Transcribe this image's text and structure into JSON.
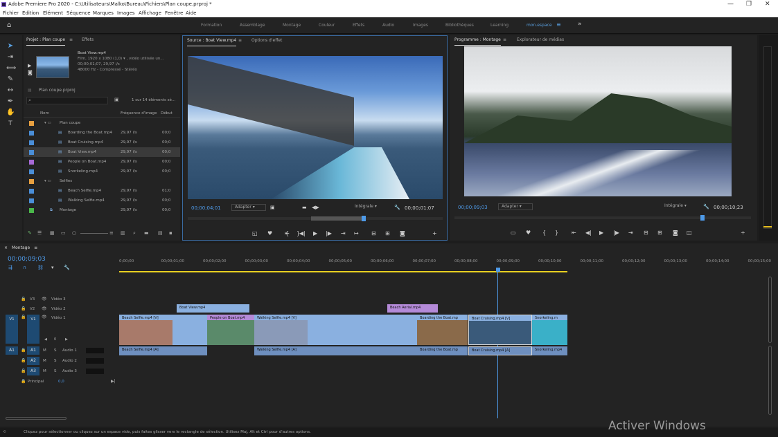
{
  "window": {
    "title": "Adobe Premiere Pro 2020 - C:\\Utilisateurs\\Malko\\Bureau\\Fichiers\\Plan coupe.prproj *",
    "min": "—",
    "max": "❐",
    "close": "✕"
  },
  "menu": [
    "Fichier",
    "Edition",
    "Elément",
    "Séquence",
    "Marques",
    "Images",
    "Affichage",
    "Fenêtre",
    "Aide"
  ],
  "workspaces": [
    "Formation",
    "Assemblage",
    "Montage",
    "Couleur",
    "Effets",
    "Audio",
    "Images",
    "Bibliothèques",
    "Learning",
    "mon.espace"
  ],
  "project": {
    "tab": "Projet : Plan coupe",
    "tab2": "Effets",
    "preview": {
      "name": "Boat View.mp4",
      "line1": "Film, 1920 x 1080 (1,0) ▾ , vidéo utilisée un...",
      "line2": "00;00;01;07, 29,97 i/s",
      "line3": "48000 Hz - Compressé - Stéréo"
    },
    "file": "Plan coupe.prproj",
    "count": "1 sur 14 éléments sé...",
    "cols": {
      "name": "Nom",
      "rate": "Fréquence d'image",
      "start": "Début"
    },
    "items": [
      {
        "name": "Plan coupe",
        "rate": "",
        "start": "",
        "color": "#e8a040",
        "kind": "folder"
      },
      {
        "name": "Boarding the Boat.mp4",
        "rate": "29,97 i/s",
        "start": "00;0",
        "color": "#4a8ed8",
        "kind": "clip"
      },
      {
        "name": "Boat Cruising.mp4",
        "rate": "29,97 i/s",
        "start": "00;0",
        "color": "#4a8ed8",
        "kind": "clip"
      },
      {
        "name": "Boat View.mp4",
        "rate": "29,97 i/s",
        "start": "00;0",
        "color": "#4a8ed8",
        "kind": "clip"
      },
      {
        "name": "People on Boat.mp4",
        "rate": "29,97 i/s",
        "start": "00;0",
        "color": "#a86ad8",
        "kind": "clip"
      },
      {
        "name": "Snorkeling.mp4",
        "rate": "29,97 i/s",
        "start": "00;0",
        "color": "#4a8ed8",
        "kind": "clip"
      },
      {
        "name": "Selfies",
        "rate": "",
        "start": "",
        "color": "#e8a040",
        "kind": "folder"
      },
      {
        "name": "Beach Selfie.mp4",
        "rate": "29,97 i/s",
        "start": "01;0",
        "color": "#4a8ed8",
        "kind": "clip"
      },
      {
        "name": "Walking Selfie.mp4",
        "rate": "29,97 i/s",
        "start": "00;0",
        "color": "#4a8ed8",
        "kind": "clip"
      },
      {
        "name": "Montage",
        "rate": "29,97 i/s",
        "start": "00;0",
        "color": "#4ab84a",
        "kind": "seq"
      }
    ]
  },
  "source": {
    "tab": "Source : Boat View.mp4",
    "tab2": "Options d'effet",
    "tc": "00;00;04;01",
    "fit": "Adapter",
    "quality": "Intégrale",
    "dur": "00;00;01;07"
  },
  "program": {
    "tab": "Programme : Montage",
    "tab2": "Explorateur de médias",
    "tc": "00;00;09;03",
    "fit": "Adapter",
    "quality": "Intégrale",
    "dur": "00;00;10;23"
  },
  "timeline": {
    "tab": "Montage",
    "tc": "00;00;09;03",
    "ruler": [
      "0;00;00",
      "00;00;01;00",
      "00;00;02;00",
      "00;00;03;00",
      "00;00;04;00",
      "00;00;05;00",
      "00;00;06;00",
      "00;00;07;00",
      "00;00;08;00",
      "00;00;09;00",
      "00;00;10;00",
      "00;00;11;00",
      "00;00;12;00",
      "00;00;13;00",
      "00;00;14;00",
      "00;00;15;00"
    ],
    "tracks": {
      "v3": "V3",
      "v2": "V2",
      "v1": "V1",
      "a1": "A1",
      "a2": "A2",
      "a3": "A3",
      "v3n": "Vidéo 3",
      "v2n": "Vidéo 2",
      "v1n": "Vidéo 1",
      "a1n": "Audio 1",
      "a2n": "Audio 2",
      "a3n": "Audio 3",
      "master": "Principal",
      "master_val": "0,0",
      "v1_vals": "0"
    },
    "clips_v2": [
      {
        "label": "Boat View.mp4"
      },
      {
        "label": "Beach Aerial.mp4"
      }
    ],
    "clips_v1": [
      {
        "label": "Beach Selfie.mp4 [V]"
      },
      {
        "label": "People on Boat.mp4"
      },
      {
        "label": "Walking Selfie.mp4 [V]"
      },
      {
        "label": "Boarding the Boat.mp"
      },
      {
        "label": "Boat Cruising.mp4 [V]"
      },
      {
        "label": "Snorkeling.m"
      }
    ],
    "clips_a1": [
      {
        "label": "Beach Selfie.mp4 [A]"
      },
      {
        "label": "Walking Selfie.mp4 [A]"
      },
      {
        "label": "Boarding the Boat.mp"
      },
      {
        "label": "Boat Cruising.mp4 [A]"
      },
      {
        "label": "Snorkeling.mp4"
      }
    ]
  },
  "status": "Cliquez pour sélectionner ou cliquez sur un espace vide, puis faites glisser vers le rectangle de sélection. Utilisez Maj, Alt et Ctrl pour d'autres options.",
  "watermark": "Activer Windows"
}
